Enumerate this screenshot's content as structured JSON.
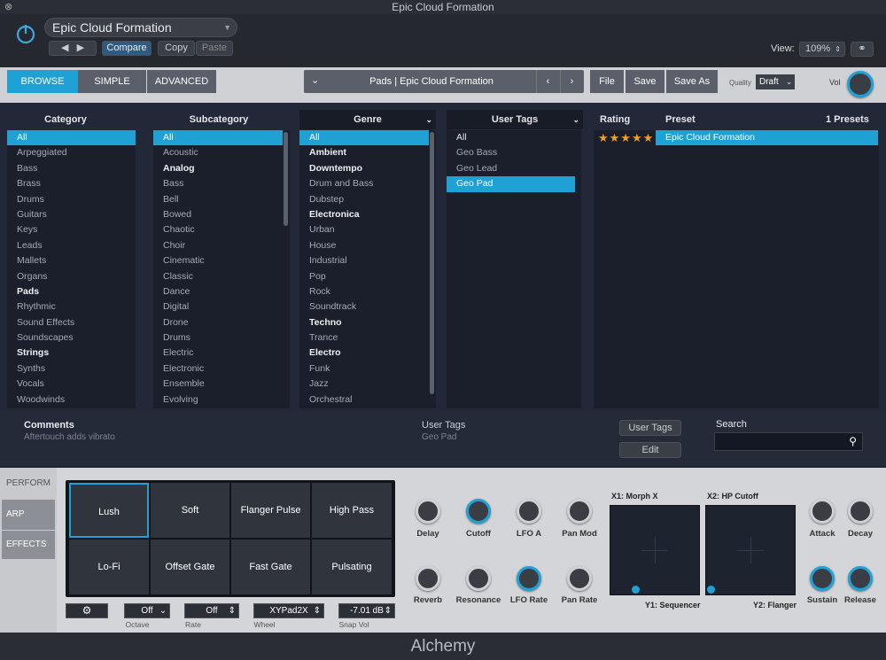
{
  "window": {
    "title": "Epic Cloud Formation"
  },
  "header": {
    "preset_name": "Epic Cloud Formation",
    "compare": "Compare",
    "copy": "Copy",
    "paste": "Paste",
    "view_label": "View:",
    "view_value": "109%"
  },
  "modes": {
    "browse": "BROWSE",
    "simple": "SIMPLE",
    "advanced": "ADVANCED"
  },
  "preset_bar": {
    "title": "Pads | Epic Cloud Formation",
    "file": "File",
    "save": "Save",
    "save_as": "Save As",
    "quality_label": "Quality",
    "quality_value": "Draft",
    "vol_label": "Vol"
  },
  "browser": {
    "category": {
      "header": "Category",
      "items": [
        "All",
        "Arpeggiated",
        "Bass",
        "Brass",
        "Drums",
        "Guitars",
        "Keys",
        "Leads",
        "Mallets",
        "Organs",
        "Pads",
        "Rhythmic",
        "Sound Effects",
        "Soundscapes",
        "Strings",
        "Synths",
        "Vocals",
        "Woodwinds"
      ]
    },
    "subcategory": {
      "header": "Subcategory",
      "items": [
        "All",
        "Acoustic",
        "Analog",
        "Bass",
        "Bell",
        "Bowed",
        "Chaotic",
        "Choir",
        "Cinematic",
        "Classic",
        "Dance",
        "Digital",
        "Drone",
        "Drums",
        "Electric",
        "Electronic",
        "Ensemble",
        "Evolving"
      ]
    },
    "genre": {
      "header": "Genre",
      "items": [
        "All",
        "Ambient",
        "Downtempo",
        "Drum and Bass",
        "Dubstep",
        "Electronica",
        "Urban",
        "House",
        "Industrial",
        "Pop",
        "Rock",
        "Soundtrack",
        "Techno",
        "Trance",
        "Electro",
        "Funk",
        "Jazz",
        "Orchestral"
      ]
    },
    "user_tags": {
      "header": "User Tags",
      "items": [
        "All",
        "Geo Bass",
        "Geo Lead",
        "Geo Pad"
      ]
    },
    "rating_header": "Rating",
    "preset_header": "Preset",
    "presets_count": "1 Presets",
    "stars": "★★★★★",
    "preset_item": "Epic Cloud Formation"
  },
  "info": {
    "comments_label": "Comments",
    "comments_value": "Aftertouch adds vibrato",
    "user_tags_label": "User Tags",
    "user_tags_value": "Geo Pad",
    "user_tags_btn": "User Tags",
    "edit_btn": "Edit",
    "search_label": "Search",
    "search_value": ""
  },
  "side_tabs": {
    "perform": "PERFORM",
    "arp": "ARP",
    "effects": "EFFECTS"
  },
  "pads": [
    "Lush",
    "Soft",
    "Flanger Pulse",
    "High Pass",
    "Lo-Fi",
    "Offset Gate",
    "Fast Gate",
    "Pulsating"
  ],
  "controls": {
    "octave_value": "Off",
    "octave_label": "Octave",
    "rate_value": "Off",
    "rate_label": "Rate",
    "wheel_value": "XYPad2X",
    "wheel_label": "Wheel",
    "snap_value": "-7.01 dB",
    "snap_label": "Snap Vol"
  },
  "knobs": {
    "delay": "Delay",
    "cutoff": "Cutoff",
    "lfo_a": "LFO A",
    "pan_mod": "Pan Mod",
    "reverb": "Reverb",
    "resonance": "Resonance",
    "lfo_rate": "LFO Rate",
    "pan_rate": "Pan Rate",
    "attack": "Attack",
    "decay": "Decay",
    "sustain": "Sustain",
    "release": "Release"
  },
  "xy": {
    "x1": "X1: Morph X",
    "x2": "X2: HP Cutoff",
    "y1": "Y1: Sequencer",
    "y2": "Y2: Flanger"
  },
  "footer": {
    "brand": "Alchemy"
  }
}
